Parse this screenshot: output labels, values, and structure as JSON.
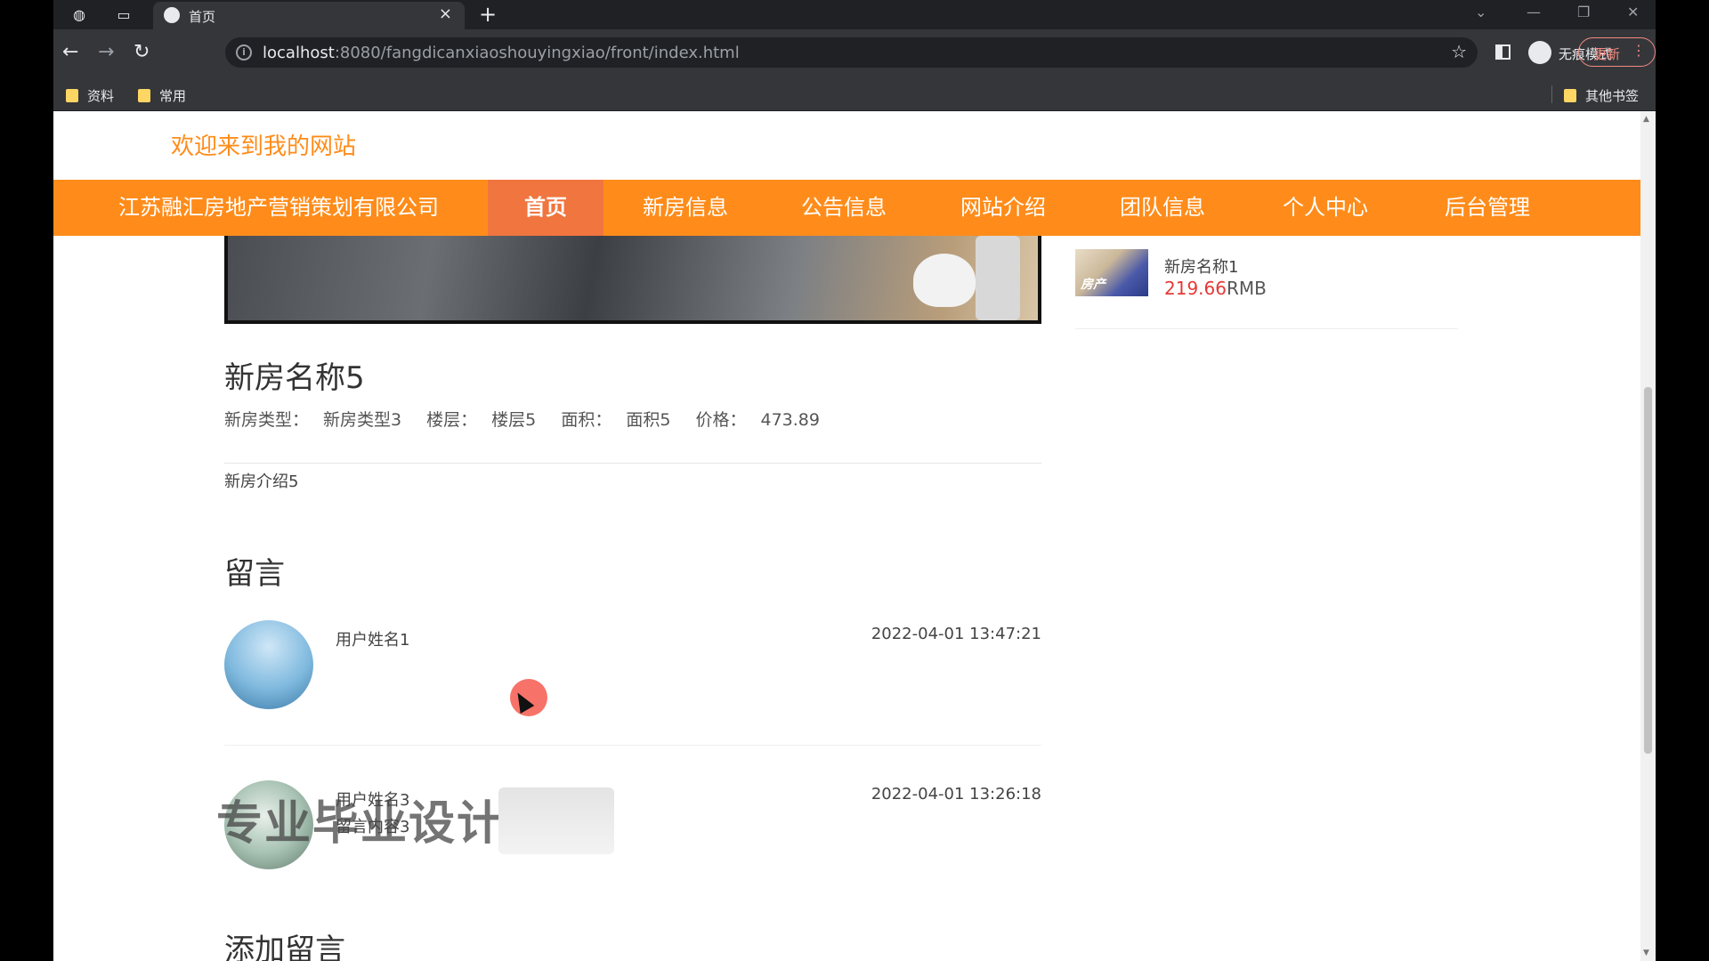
{
  "browser": {
    "tab_title": "首页",
    "tab_close": "×",
    "new_tab": "+",
    "url_host": "localhost",
    "url_rest": ":8080/fangdicanxiaoshouyingxiao/front/index.html",
    "incognito_label": "无痕模式",
    "update_label": "更新",
    "bookmarks": [
      "资料",
      "常用"
    ],
    "other_bookmarks": "其他书签"
  },
  "site": {
    "welcome": "欢迎来到我的网站",
    "brand": "江苏融汇房地产营销策划有限公司",
    "nav": [
      "首页",
      "新房信息",
      "公告信息",
      "网站介绍",
      "团队信息",
      "个人中心",
      "后台管理"
    ]
  },
  "house": {
    "title": "新房名称5",
    "type_label": "新房类型：",
    "type_value": "新房类型3",
    "floor_label": "楼层：",
    "floor_value": "楼层5",
    "area_label": "面积：",
    "area_value": "面积5",
    "price_label": "价格：",
    "price_value": "473.89",
    "intro": "新房介绍5"
  },
  "messages": {
    "title": "留言",
    "items": [
      {
        "name": "用户姓名1",
        "time": "2022-04-01 13:47:21",
        "content": ""
      },
      {
        "name": "用户姓名3",
        "time": "2022-04-01 13:26:18",
        "content": "留言内容3"
      }
    ],
    "add_title": "添加留言"
  },
  "sidebar": {
    "item_name": "新房名称1",
    "item_price": "219.66",
    "item_currency": "RMB",
    "thumb_tag": "房产"
  },
  "watermark": "专业毕业设计",
  "colors": {
    "nav_bg": "#ff8c1a",
    "nav_active": "#f0753e",
    "price_red": "#e53935"
  }
}
